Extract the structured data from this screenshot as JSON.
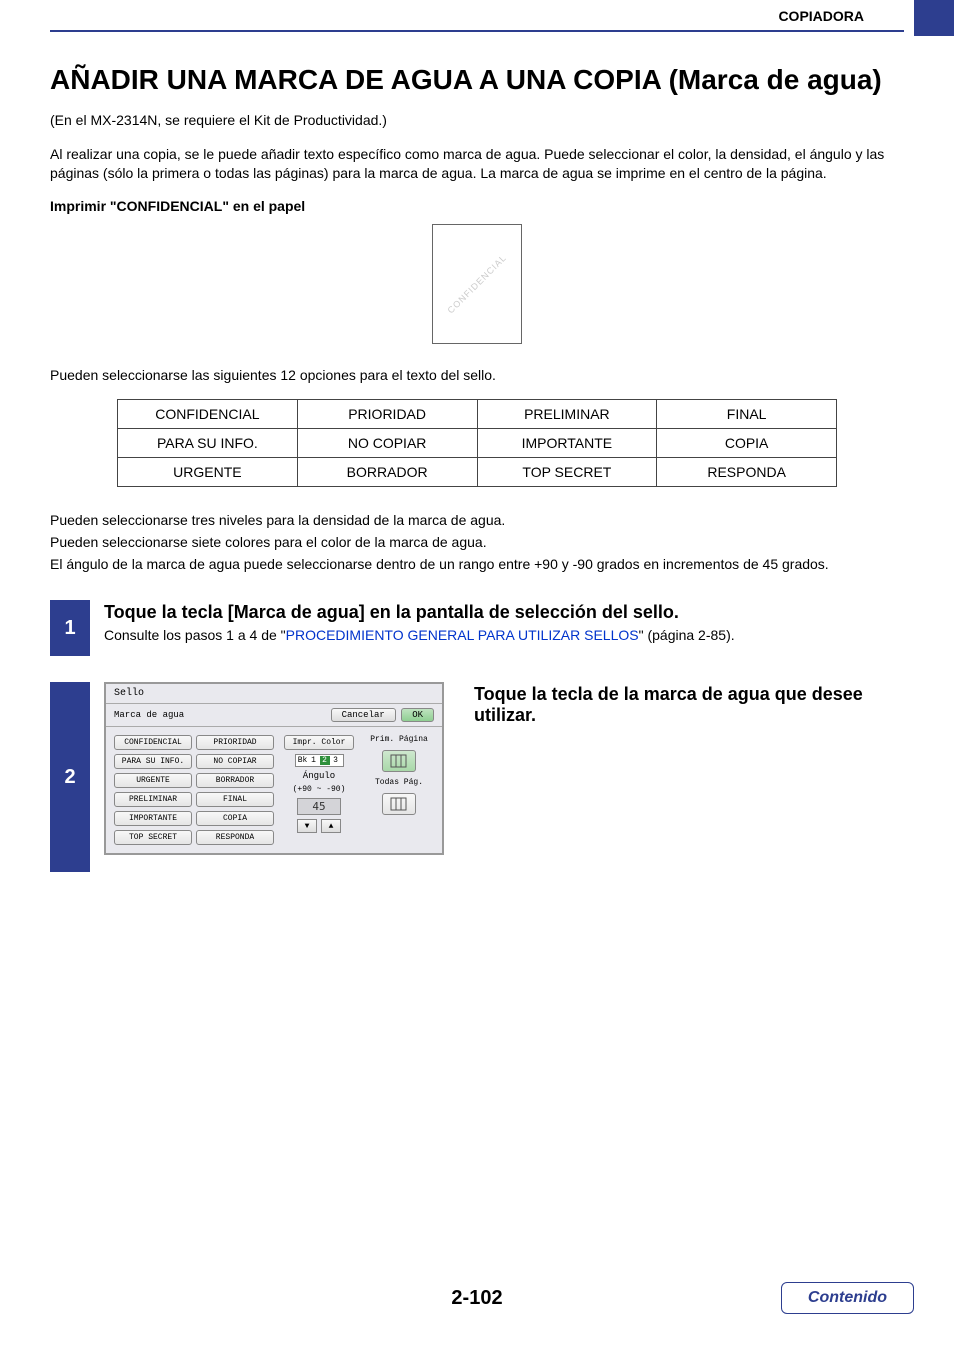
{
  "header": {
    "category": "COPIADORA"
  },
  "title": "AÑADIR UNA MARCA DE AGUA A UNA COPIA (Marca de agua)",
  "intro_note": "(En el MX-2314N, se requiere el Kit de Productividad.)",
  "intro_body": "Al realizar una copia, se le puede añadir texto específico como marca de agua. Puede seleccionar el color, la densidad, el ángulo y las páginas (sólo la primera o todas las páginas) para la marca de agua. La marca de agua se imprime en el centro de la página.",
  "example_heading": "Imprimir \"CONFIDENCIAL\" en el papel",
  "watermark_sample": "CONFIDENCIAL",
  "options_intro": "Pueden seleccionarse las siguientes 12 opciones para el texto del sello.",
  "options": [
    [
      "CONFIDENCIAL",
      "PRIORIDAD",
      "PRELIMINAR",
      "FINAL"
    ],
    [
      "PARA SU INFO.",
      "NO COPIAR",
      "IMPORTANTE",
      "COPIA"
    ],
    [
      "URGENTE",
      "BORRADOR",
      "TOP SECRET",
      "RESPONDA"
    ]
  ],
  "notes": {
    "density": "Pueden seleccionarse tres niveles para la densidad de la marca de agua.",
    "color": "Pueden seleccionarse siete colores para el color de la marca de agua.",
    "angle": "El ángulo de la marca de agua puede seleccionarse dentro de un rango entre +90 y -90 grados en incrementos de 45 grados."
  },
  "step1": {
    "num": "1",
    "title": "Toque la tecla [Marca de agua] en la pantalla de selección del sello.",
    "desc_prefix": "Consulte los pasos 1 a 4 de \"",
    "desc_link": "PROCEDIMIENTO GENERAL PARA UTILIZAR SELLOS",
    "desc_suffix": "\" (página 2-85)."
  },
  "step2": {
    "num": "2",
    "title": "Toque la tecla de la marca de agua que desee utilizar.",
    "panel": {
      "head": "Sello",
      "sub": "Marca de agua",
      "cancel": "Cancelar",
      "ok": "OK",
      "options": [
        "CONFIDENCIAL",
        "PRIORIDAD",
        "PARA SU INFO.",
        "NO COPIAR",
        "URGENTE",
        "BORRADOR",
        "PRELIMINAR",
        "FINAL",
        "IMPORTANTE",
        "COPIA",
        "TOP SECRET",
        "RESPONDA"
      ],
      "impr_color": "Impr. Color",
      "bk": "Bk",
      "d1": "1",
      "d2": "2",
      "d3": "3",
      "angulo": "Ángulo",
      "angulo_range": "(+90 ~ -90)",
      "angulo_val": "45",
      "prim": "Prim. Página",
      "todas": "Todas Pág."
    }
  },
  "footer": {
    "page": "2-102",
    "link": "Contenido"
  }
}
